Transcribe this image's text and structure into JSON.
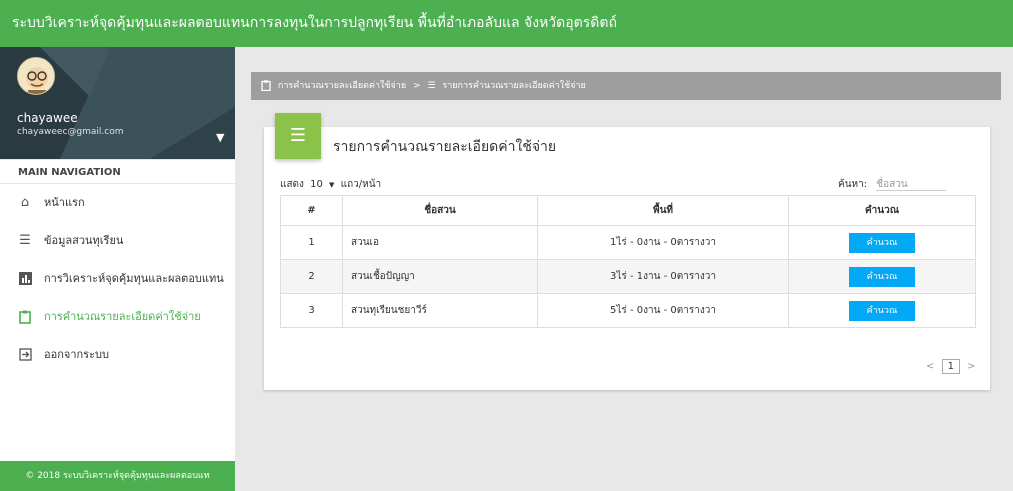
{
  "app_title": "ระบบวิเคราะห์จุดคุ้มทุนและผลตอบแทนการลงทุนในการปลูกทุเรียน พื้นที่อำเภอลับแล จังหวัดอุตรดิตถ์",
  "user": {
    "name": "chayawee",
    "email": "chayaweec@gmail.com"
  },
  "sidebar": {
    "heading": "MAIN NAVIGATION",
    "items": [
      {
        "label": "หน้าแรก",
        "icon": "home-icon"
      },
      {
        "label": "ข้อมูลสวนทุเรียน",
        "icon": "list-icon"
      },
      {
        "label": "การวิเคราะห์จุดคุ้มทุนและผลตอบแทน",
        "icon": "bar-chart-icon"
      },
      {
        "label": "การคำนวณรายละเอียดค่าใช้จ่าย",
        "icon": "clipboard-icon",
        "active": true
      },
      {
        "label": "ออกจากระบบ",
        "icon": "logout-icon"
      }
    ],
    "footer": "© 2018 ระบบวิเคราะห์จุดคุ้มทุนและผลตอบแท"
  },
  "breadcrumb": {
    "item1": "การคำนวณรายละเอียดค่าใช้จ่าย",
    "sep": ">",
    "item2": "รายการคำนวณรายละเอียดค่าใช้จ่าย"
  },
  "card": {
    "title": "รายการคำนวณรายละเอียดค่าใช้จ่าย",
    "length_prefix": "แสดง",
    "length_value": "10",
    "length_suffix": "แถว/หน้า",
    "search_label": "ค้นหา:",
    "search_placeholder": "ชื่อสวน"
  },
  "table": {
    "headers": [
      "#",
      "ชื่อสวน",
      "พื้นที่",
      "คำนวณ"
    ],
    "rows": [
      {
        "num": "1",
        "name": "สวนเอ",
        "area": "1ไร่ - 0งาน - 0ตารางวา",
        "action": "คำนวณ"
      },
      {
        "num": "2",
        "name": "สวนเชื้อปัญญา",
        "area": "3ไร่ - 1งาน - 0ตารางวา",
        "action": "คำนวณ"
      },
      {
        "num": "3",
        "name": "สวนทุเรียนชยาวีร์",
        "area": "5ไร่ - 0งาน - 0ตารางวา",
        "action": "คำนวณ"
      }
    ]
  },
  "pager": {
    "prev": "<",
    "current": "1",
    "next": ">"
  },
  "colors": {
    "primary_green": "#4caf50",
    "light_green": "#8bc34a",
    "button_blue": "#03a9f4",
    "breadcrumb_gray": "#9e9e9e"
  }
}
